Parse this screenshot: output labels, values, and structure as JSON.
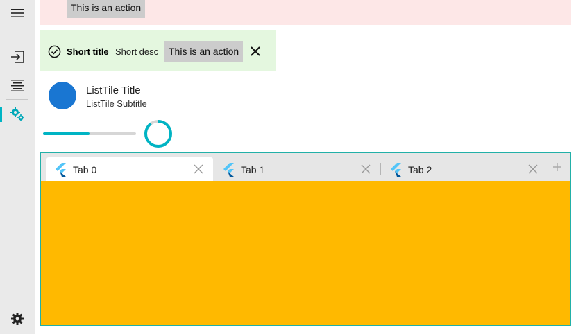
{
  "nav_rail": {
    "items": [
      {
        "icon": "menu-icon"
      },
      {
        "icon": "login-icon"
      },
      {
        "icon": "align-center-icon"
      },
      {
        "icon": "settings-cogs-icon",
        "selected": true
      },
      {
        "icon": "gear-icon"
      }
    ],
    "accent": "#00b4c4"
  },
  "error_banner": {
    "action_label": "This is an action",
    "background": "#fde7e7"
  },
  "success_banner": {
    "icon": "check-circle-icon",
    "title": "Short title",
    "description": "Short desc",
    "action_label": "This is an action",
    "close_icon": "close-icon",
    "background": "#e4f7df"
  },
  "list_tile": {
    "title": "ListTile Title",
    "subtitle": "ListTile Subtitle",
    "avatar_color": "#1976d2"
  },
  "progress": {
    "linear_value": 0.5,
    "ring_value": 0.9,
    "color": "#00b4c4"
  },
  "tab_view": {
    "tabs": [
      {
        "label": "Tab 0",
        "selected": true
      },
      {
        "label": "Tab 1",
        "selected": false
      },
      {
        "label": "Tab 2",
        "selected": false
      }
    ],
    "content_color": "#ffb900",
    "add_icon": "plus-icon"
  }
}
